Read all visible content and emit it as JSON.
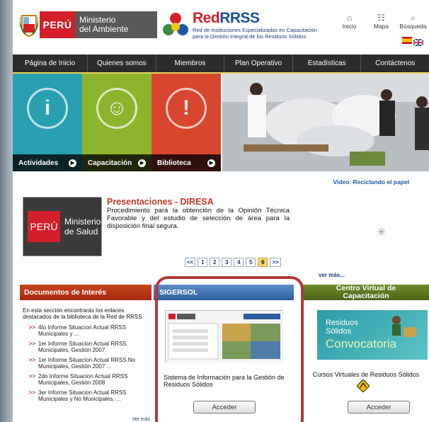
{
  "header": {
    "peru_text": "PERÚ",
    "ministry_line1": "Ministerio",
    "ministry_line2": "del Ambiente",
    "rrss_red": "Red",
    "rrss_blue": "RRSS",
    "rrss_sub_line1": "Red de Instituciones Especializadas en Capacitación",
    "rrss_sub_line2": "para la Gestión Integral de los Residuos Sólidos",
    "links": [
      {
        "label": "Inicio",
        "icon": "home-icon"
      },
      {
        "label": "Mapa",
        "icon": "sitemap-icon"
      },
      {
        "label": "Búsqueda",
        "icon": "search-icon"
      }
    ]
  },
  "nav": {
    "items": [
      "Página de Inicio",
      "Quienes somos",
      "Miembros",
      "Plan Operativo",
      "Estadísticas",
      "Contáctenos"
    ]
  },
  "banner": {
    "tiles": [
      {
        "label": "Actividades",
        "color": "#2a9fb0",
        "glyph": "i"
      },
      {
        "label": "Capacitación",
        "color": "#8db32c",
        "glyph": "☺"
      },
      {
        "label": "Biblioteca",
        "color": "#d8462e",
        "glyph": "!"
      }
    ],
    "video_link": "Video: Reciclando el papel"
  },
  "presentation": {
    "logo_peru": "PERÚ",
    "logo_line1": "Ministerio",
    "logo_line2": "de Salud",
    "title": "Presentaciones - DIRESA",
    "text": "Procedimiento para la obtención de la Opinión Técnica Favorable y del estudio de selección de área para la disposición final segura."
  },
  "pager": {
    "prev": "<<",
    "pages": [
      "1",
      "2",
      "3",
      "4",
      "5",
      "6"
    ],
    "active": "6",
    "next": ">>",
    "more": "ver más..."
  },
  "documents": {
    "title": "Documentos de Interés",
    "intro": "En esta sección encontrarás los enlaces destacados de la biblioteca de la Red de RRSS",
    "items": [
      "4to Informe Situacion Actual RRSS Municipales y ...",
      "1er Informe Situacion Actual RRSS Municipales, Gestión 2007",
      "1er Informe Situacion Actual RRSS No Municipales, Gestión 2007 ...",
      "2do Informe Situacion Actual RRSS Municipales, Gestión 2008",
      "3er Informe Situacion Actual RRSS Municipales y No Municipales, ..."
    ],
    "more": "Ver más"
  },
  "sigersol": {
    "title": "SIGERSOL",
    "description": "Sistema de Información para la Gestión de Residuos Sólidos",
    "button": "Acceder"
  },
  "centro_virtual": {
    "title_line1": "Centro Virtual de",
    "title_line2": "Capacitación",
    "banner_line1": "Residuos",
    "banner_line2": "Sólidos",
    "banner_big": "Convocatoria",
    "description": "Cursos Virtuales de Residuos Sólidos",
    "button": "Acceder"
  }
}
